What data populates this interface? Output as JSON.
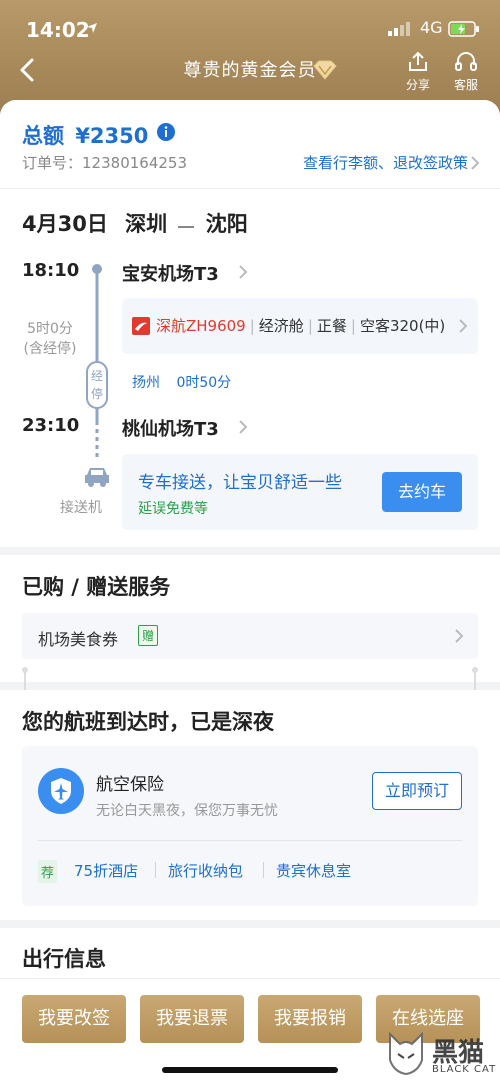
{
  "status_bar": {
    "time": "14:02",
    "network": "4G"
  },
  "nav": {
    "title": "尊贵的黄金会员",
    "share_label": "分享",
    "service_label": "客服"
  },
  "summary": {
    "total_label": "总额",
    "total_value": "¥2350",
    "order_label": "订单号：",
    "order_number": "12380164253",
    "policy_link": "查看行李额、退改签政策"
  },
  "itinerary": {
    "date": "4月30日",
    "from_city": "深圳",
    "to_city": "沈阳",
    "depart_time": "18:10",
    "depart_airport": "宝安机场T3",
    "duration": "5时0分",
    "duration_note": "(含经停)",
    "stop_badge": "经停",
    "flight": {
      "airline_flight": "深航ZH9609",
      "cabin": "经济舱",
      "meal": "正餐",
      "aircraft": "空客320(中)"
    },
    "stop_city": "扬州",
    "stop_duration": "0时50分",
    "arrive_time": "23:10",
    "arrive_airport": "桃仙机场T3",
    "pickup_label": "接送机",
    "transfer_title": "专车接送，让宝贝舒适一些",
    "transfer_sub": "延误免费等",
    "transfer_button": "去约车"
  },
  "services": {
    "title": "已购 / 赠送服务",
    "item_name": "机场美食券",
    "item_badge": "赠"
  },
  "late_night": {
    "title": "您的航班到达时，已是深夜",
    "insurance_title": "航空保险",
    "insurance_sub": "无论白天黑夜，保您万事无忧",
    "insurance_button": "立即预订",
    "recommend_badge": "荐",
    "links": [
      "75折酒店",
      "旅行收纳包",
      "贵宾休息室"
    ]
  },
  "travel_info": {
    "title": "出行信息"
  },
  "actions": [
    "我要改签",
    "我要退票",
    "我要报销",
    "在线选座"
  ],
  "watermark": {
    "text": "黑猫",
    "sub": "BLACK CAT"
  },
  "colors": {
    "gold": "#b69158",
    "blue": "#1e6fd0",
    "green": "#2aa049"
  }
}
